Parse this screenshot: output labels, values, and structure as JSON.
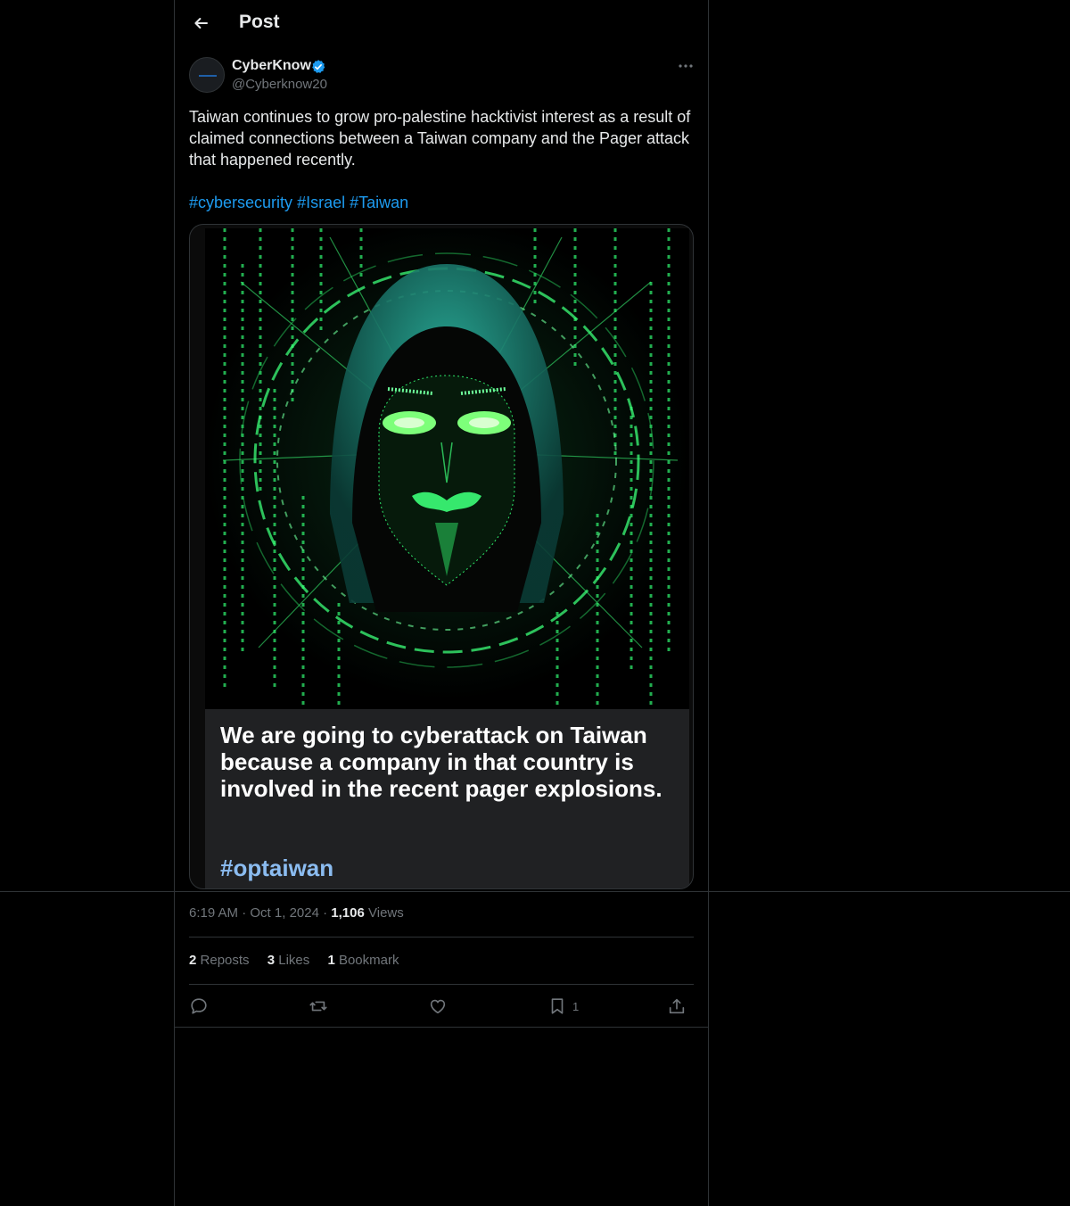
{
  "header": {
    "title": "Post"
  },
  "post": {
    "author_name": "CyberKnow",
    "author_handle": "@Cyberknow20",
    "text": "Taiwan continues to grow pro-palestine hacktivist interest as a result of claimed connections between a Taiwan company and the Pager attack that happened recently.",
    "hashtags": [
      "#cybersecurity",
      "#Israel",
      "#Taiwan"
    ],
    "image": {
      "caption": "We are going to cyberattack on Taiwan because a company in that country is involved in the recent pager explosions.",
      "caption_tag": "#optaiwan"
    },
    "time": "6:19 AM",
    "date": "Oct 1, 2024",
    "views_count": "1,106",
    "views_label": "Views",
    "dot": "·"
  },
  "stats": {
    "reposts_count": "2",
    "reposts_label": "Reposts",
    "likes_count": "3",
    "likes_label": "Likes",
    "bookmarks_count": "1",
    "bookmarks_label": "Bookmark"
  },
  "actions": {
    "bookmark_count": "1"
  },
  "colors": {
    "accent": "#1d9bf0",
    "background": "#000000",
    "border": "#2f3336",
    "muted": "#71767b",
    "matrix_green": "#39ff6a"
  },
  "icons": [
    "back-arrow-icon",
    "verified-badge-icon",
    "more-icon",
    "reply-icon",
    "repost-icon",
    "like-icon",
    "bookmark-icon",
    "share-icon"
  ]
}
